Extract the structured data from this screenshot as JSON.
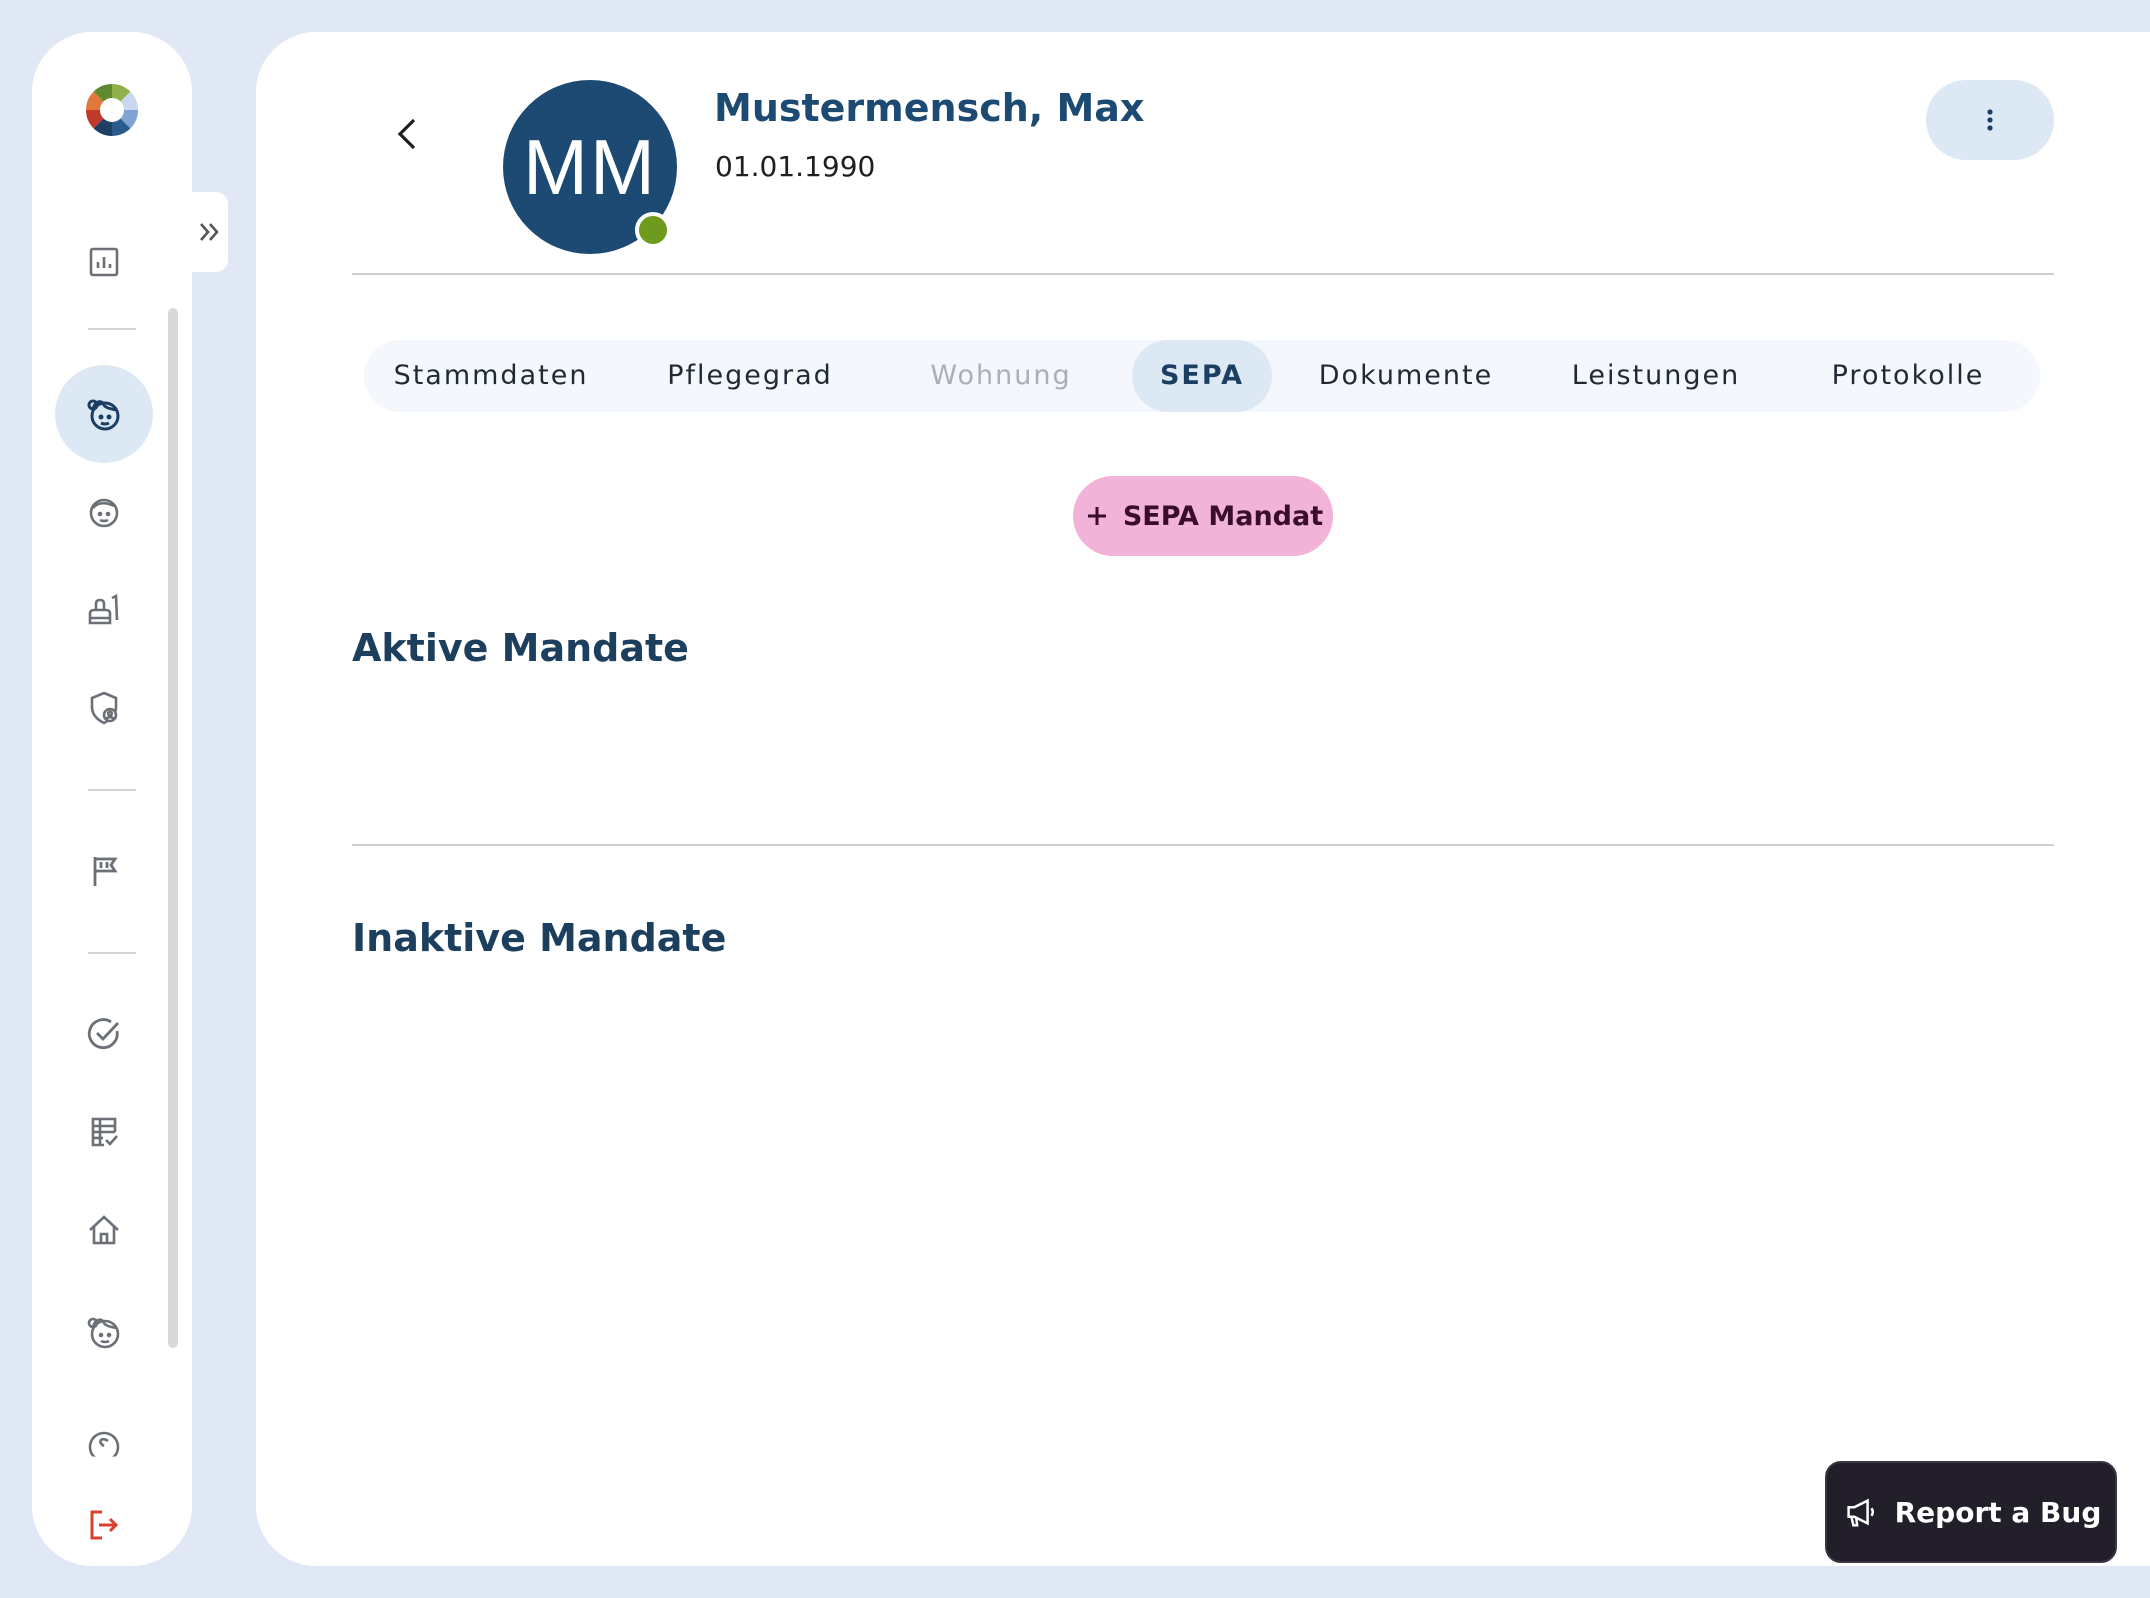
{
  "patient": {
    "initials": "MM",
    "name": "Mustermensch, Max",
    "birthdate": "01.01.1990"
  },
  "tabs": [
    {
      "label": "Stammdaten"
    },
    {
      "label": "Pflegegrad"
    },
    {
      "label": "Wohnung"
    },
    {
      "label": "SEPA"
    },
    {
      "label": "Dokumente"
    },
    {
      "label": "Leistungen"
    },
    {
      "label": "Protokolle"
    }
  ],
  "actions": {
    "add_sepa_label": "SEPA Mandat",
    "report_bug_label": "Report a Bug"
  },
  "sections": {
    "active_title": "Aktive Mandate",
    "inactive_title": "Inaktive Mandate"
  },
  "colors": {
    "accent": "#1d4a72",
    "status_online": "#6e9b1d",
    "primary_button": "#f1b3d8",
    "logout": "#d9412f"
  }
}
